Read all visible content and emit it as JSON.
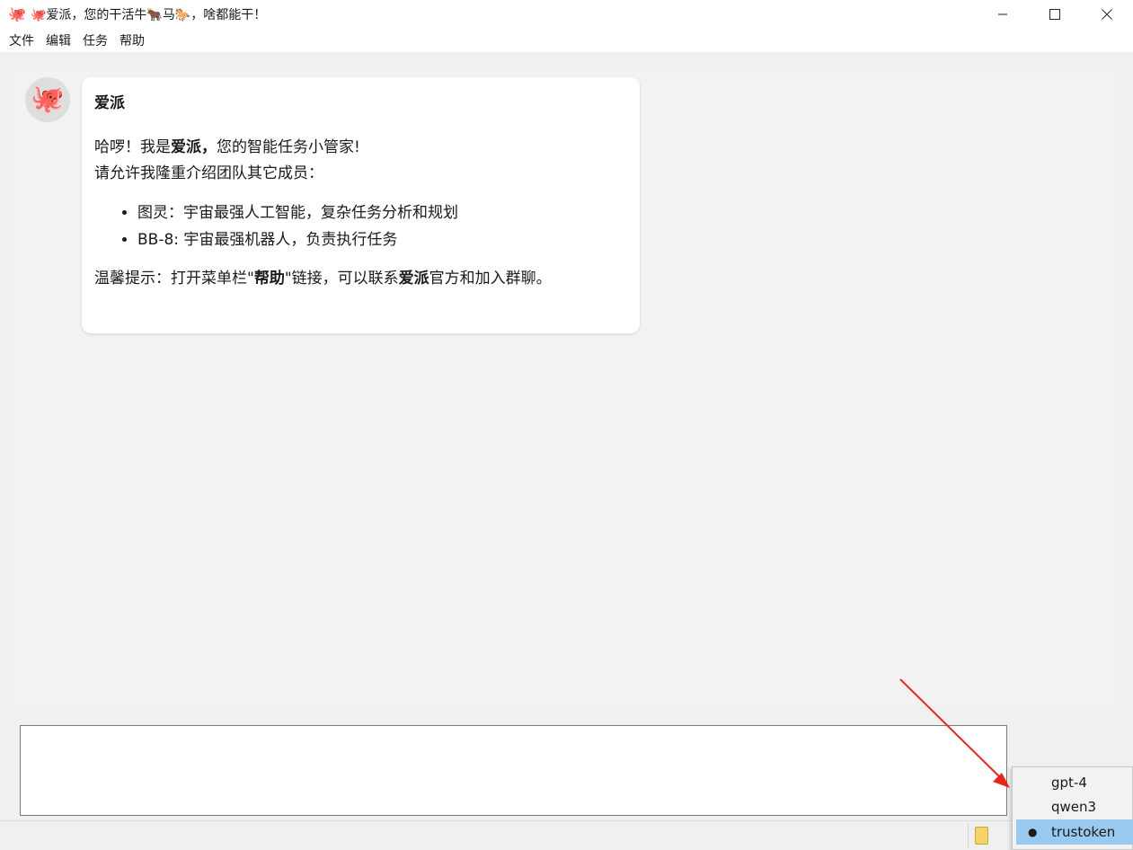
{
  "window": {
    "title": "🐙爱派，您的干活牛🐂马🐎，啥都能干！",
    "app_icon": "octopus-icon"
  },
  "menu": [
    "文件",
    "编辑",
    "任务",
    "帮助"
  ],
  "chat": {
    "sender": "爱派",
    "greeting_a": "哈啰！我是",
    "greeting_b": "爱派，",
    "greeting_c": "您的智能任务小管家!",
    "intro": "请允许我隆重介绍团队其它成员：",
    "members": [
      "图灵：宇宙最强人工智能，复杂任务分析和规划",
      "BB-8: 宇宙最强机器人，负责执行任务"
    ],
    "tip_a": "温馨提示：打开菜单栏\"",
    "tip_b": "帮助",
    "tip_c": "\"链接，可以联系",
    "tip_d": "爱派",
    "tip_e": "官方和加入群聊。"
  },
  "input": {
    "value": ""
  },
  "model_menu": {
    "items": [
      "gpt-4",
      "qwen3",
      "trustoken"
    ],
    "selected": "trustoken"
  },
  "colors": {
    "selected_bg": "#99c9ef",
    "arrow": "#e8261c",
    "avatar_octopus": "#e8611a"
  }
}
